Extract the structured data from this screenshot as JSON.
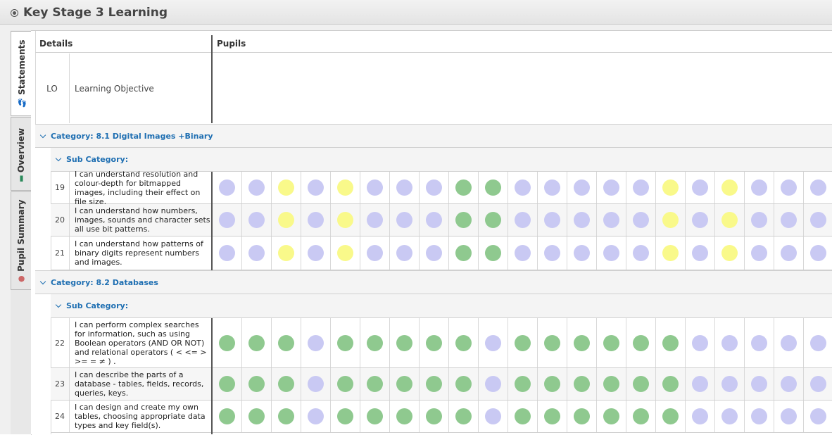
{
  "window": {
    "title": "Key Stage 3 Learning"
  },
  "tabs": [
    {
      "label": "Statements",
      "icon": "footprints-icon",
      "active": true
    },
    {
      "label": "Overview",
      "icon": "book-icon",
      "active": false
    },
    {
      "label": "Pupil Summary",
      "icon": "person-icon",
      "active": false
    }
  ],
  "headers": {
    "details": "Details",
    "pupils": "Pupils"
  },
  "lo_row": {
    "code": "LO",
    "label": "Learning Objective"
  },
  "colors": {
    "amber": "#c9c9f3",
    "yellow": "#f9f98a",
    "green": "#8fc98f",
    "link": "#1f6fb2"
  },
  "categories": [
    {
      "label": "Category: 8.1 Digital Images +Binary",
      "subcategory": "Sub Category:",
      "rows": [
        {
          "num": "19",
          "text": "I can understand resolution and colour-depth for bitmapped images, including their effect on file size.",
          "marks": [
            "a",
            "a",
            "y",
            "a",
            "y",
            "a",
            "a",
            "a",
            "g",
            "g",
            "a",
            "a",
            "a",
            "a",
            "a",
            "y",
            "a",
            "y",
            "a",
            "a",
            "a"
          ]
        },
        {
          "num": "20",
          "text": "I can understand how numbers, images, sounds and character sets all use bit patterns.",
          "marks": [
            "a",
            "a",
            "y",
            "a",
            "y",
            "a",
            "a",
            "a",
            "g",
            "g",
            "a",
            "a",
            "a",
            "a",
            "a",
            "y",
            "a",
            "y",
            "a",
            "a",
            "a"
          ]
        },
        {
          "num": "21",
          "text": "I can understand how patterns of binary digits represent numbers and images.",
          "marks": [
            "a",
            "a",
            "y",
            "a",
            "y",
            "a",
            "a",
            "a",
            "g",
            "g",
            "a",
            "a",
            "a",
            "a",
            "a",
            "y",
            "a",
            "y",
            "a",
            "a",
            "a"
          ]
        }
      ]
    },
    {
      "label": "Category: 8.2 Databases",
      "subcategory": "Sub Category:",
      "rows": [
        {
          "num": "22",
          "text": "I can perform complex searches for information, such as using Boolean operators (AND OR NOT) and relational operators ( < <= > >= = ≠ ) .",
          "marks": [
            "g",
            "g",
            "g",
            "a",
            "g",
            "g",
            "g",
            "g",
            "g",
            "a",
            "g",
            "g",
            "g",
            "g",
            "g",
            "g",
            "a",
            "a",
            "a",
            "a",
            "a"
          ]
        },
        {
          "num": "23",
          "text": "I can describe the parts of a database - tables, fields, records, queries, keys.",
          "marks": [
            "g",
            "g",
            "g",
            "a",
            "g",
            "g",
            "g",
            "g",
            "g",
            "a",
            "g",
            "g",
            "g",
            "g",
            "g",
            "g",
            "a",
            "a",
            "a",
            "a",
            "a"
          ]
        },
        {
          "num": "24",
          "text": "I can design and create my own tables, choosing appropriate data types and key field(s).",
          "marks": [
            "g",
            "g",
            "g",
            "a",
            "g",
            "g",
            "g",
            "g",
            "g",
            "a",
            "g",
            "g",
            "g",
            "g",
            "g",
            "g",
            "a",
            "a",
            "a",
            "a",
            "a"
          ]
        }
      ]
    }
  ]
}
